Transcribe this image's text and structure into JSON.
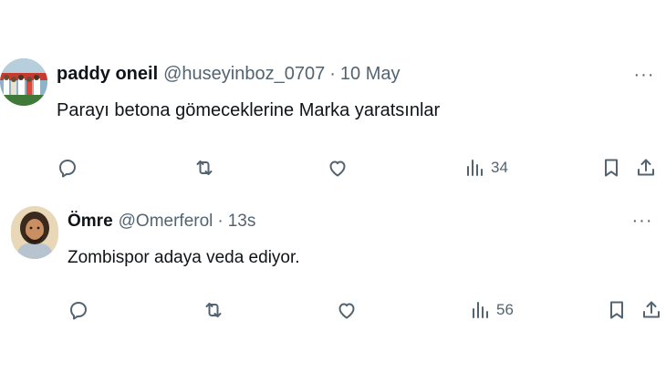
{
  "tweets": [
    {
      "display_name": "paddy oneil",
      "handle": "@huseyinboz_0707",
      "separator": "·",
      "time": "10 May",
      "more_label": "···",
      "text": "Parayı betona gömeceklerine Marka yaratsınlar",
      "views": "34",
      "icons": {
        "reply": "reply-icon",
        "retweet": "retweet-icon",
        "like": "like-icon",
        "views": "views-icon",
        "bookmark": "bookmark-icon",
        "share": "share-icon"
      }
    },
    {
      "display_name": "Ömre",
      "handle": "@Omerferol",
      "separator": "·",
      "time": "13s",
      "more_label": "···",
      "text": "Zombispor adaya veda ediyor.",
      "views": "56",
      "icons": {
        "reply": "reply-icon",
        "retweet": "retweet-icon",
        "like": "like-icon",
        "views": "views-icon",
        "bookmark": "bookmark-icon",
        "share": "share-icon"
      }
    }
  ],
  "colors": {
    "primary_text": "#0f1419",
    "secondary_text": "#536471",
    "background": "#ffffff"
  }
}
